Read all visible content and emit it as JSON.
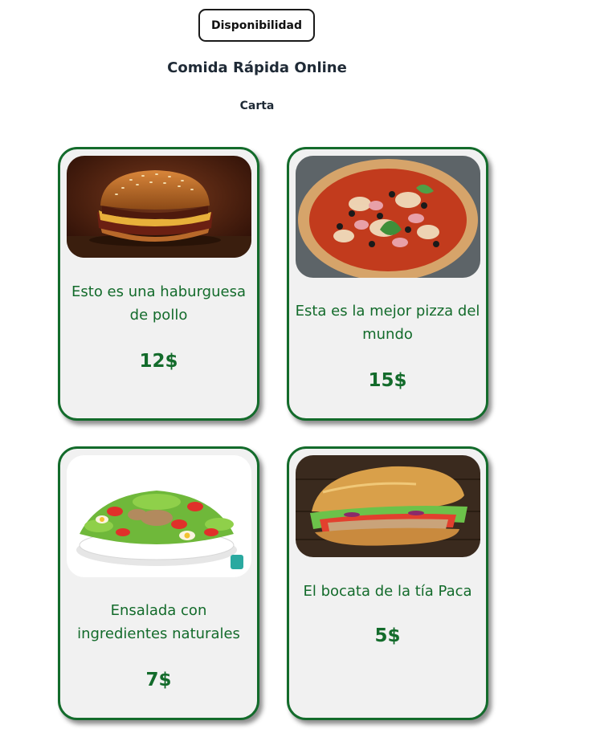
{
  "header": {
    "availability_button": "Disponibilidad",
    "site_title": "Comida Rápida Online",
    "section_title": "Carta"
  },
  "menu": {
    "items": [
      {
        "description": "Esto es una haburguesa de pollo",
        "price": "12$",
        "image_icon": "burger-image"
      },
      {
        "description": "Esta es la mejor pizza del mundo",
        "price": "15$",
        "image_icon": "pizza-image"
      },
      {
        "description": "Ensalada con ingredientes naturales",
        "price": "7$",
        "image_icon": "salad-image"
      },
      {
        "description": "El bocata de la tía Paca",
        "price": "5$",
        "image_icon": "sandwich-image"
      }
    ]
  },
  "colors": {
    "accent_green": "#136b2b",
    "card_background": "#f1f1f1",
    "title_text": "#1f2a36"
  }
}
